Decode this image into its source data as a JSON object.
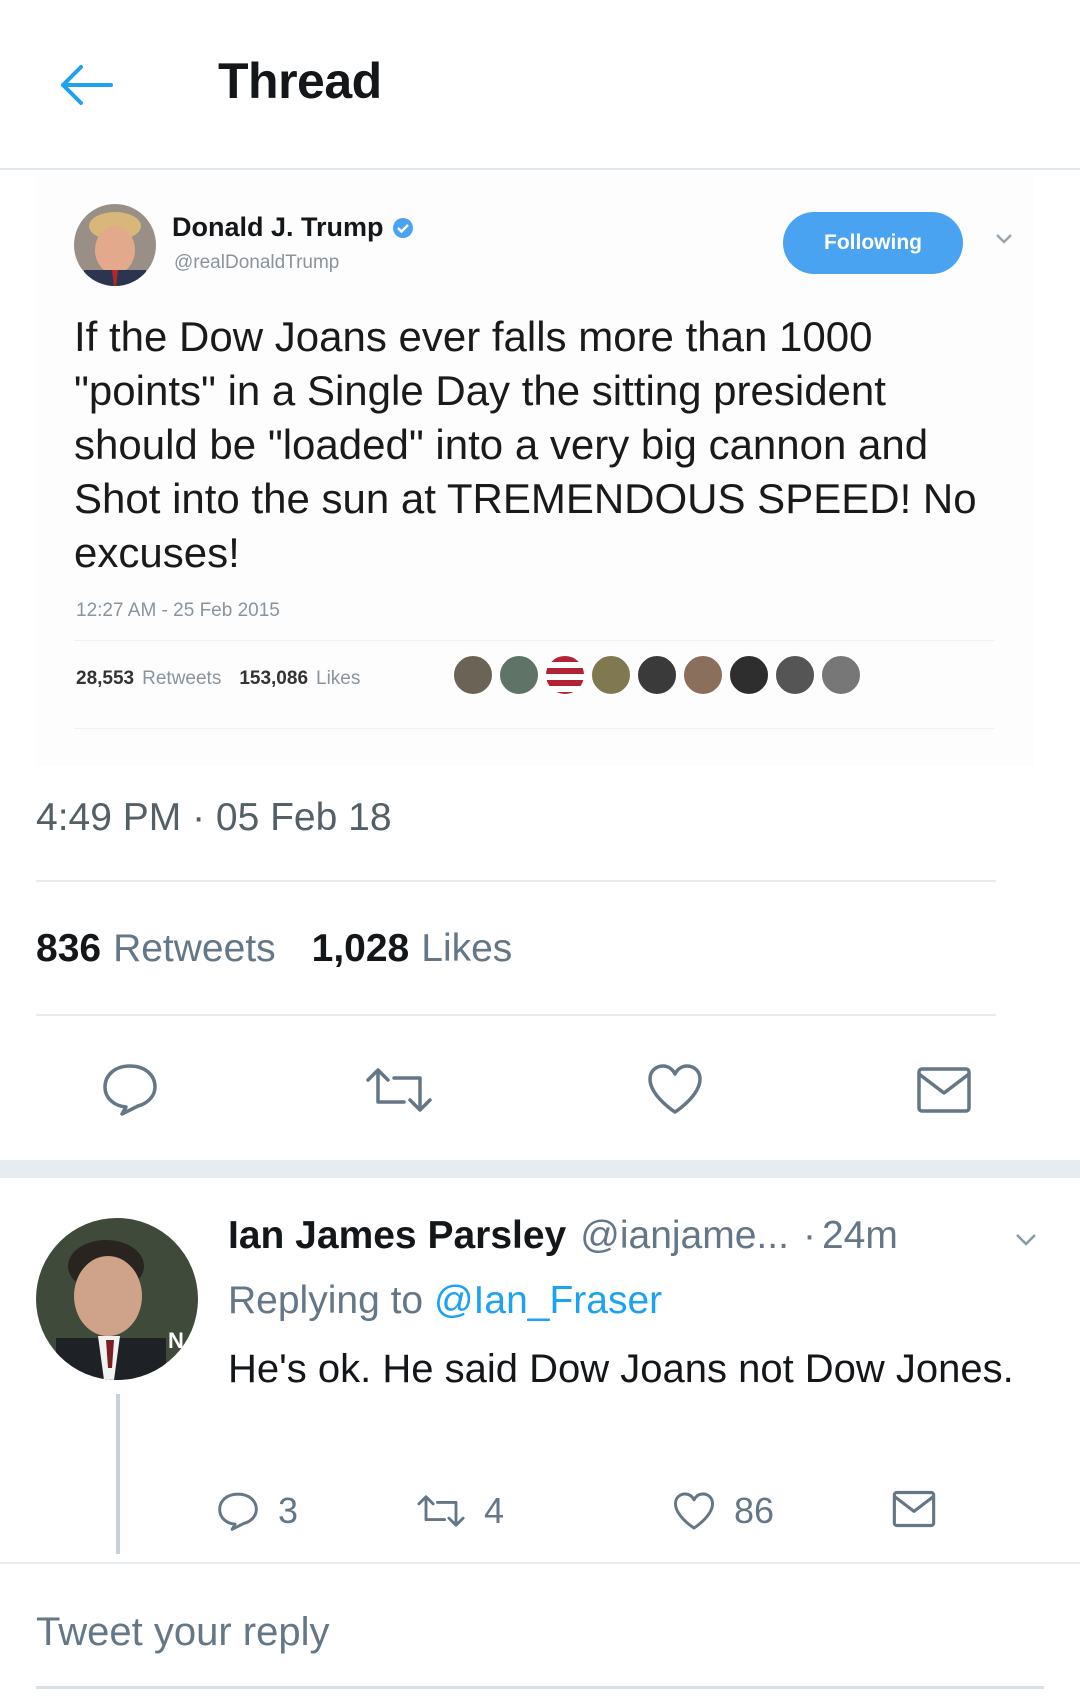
{
  "header": {
    "title": "Thread"
  },
  "embedded_tweet": {
    "author_name": "Donald J. Trump",
    "author_handle": "@realDonaldTrump",
    "follow_label": "Following",
    "text": "If the Dow Joans ever falls more than 1000 \"points\" in a Single Day the sitting president should be \"loaded\" into a very big cannon and Shot into the sun at TREMENDOUS SPEED! No excuses!",
    "timestamp": "12:27 AM - 25 Feb 2015",
    "retweets_count": "28,553",
    "retweets_label": "Retweets",
    "likes_count": "153,086",
    "likes_label": "Likes"
  },
  "tweet": {
    "timestamp": "4:49 PM · 05 Feb 18",
    "retweets_count": "836",
    "retweets_label": "Retweets",
    "likes_count": "1,028",
    "likes_label": "Likes"
  },
  "reply": {
    "author_name": "Ian James Parsley",
    "author_handle": "@ianjame...",
    "separator": "·",
    "age": "24m",
    "replying_prefix": "Replying to",
    "replying_to": "@Ian_Fraser",
    "text": "He's ok. He said Dow Joans not Dow Jones.",
    "reply_count": "3",
    "retweet_count": "4",
    "like_count": "86"
  },
  "composer": {
    "placeholder": "Tweet your reply"
  },
  "colors": {
    "accent": "#1da1f2",
    "follow_button": "#4aa3f0",
    "muted_text": "#657786"
  },
  "icons": [
    "back-arrow-icon",
    "verified-badge-icon",
    "chevron-down-icon",
    "reply-icon",
    "retweet-icon",
    "like-icon",
    "message-icon"
  ]
}
